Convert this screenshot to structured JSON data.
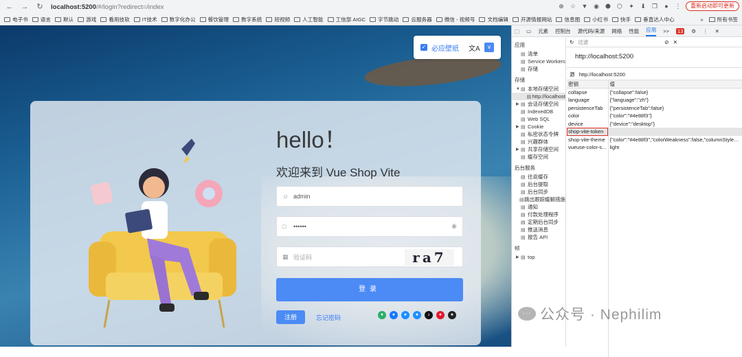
{
  "browser": {
    "url_host": "localhost:5200",
    "url_path": "/#/login?redirect=/index",
    "restart_label": "重新启动即可更新",
    "nav": {
      "back": "←",
      "forward": "→",
      "reload": "↻"
    },
    "toolbar_icons": [
      "⊕",
      "☆",
      "▼",
      "◉",
      "⬢",
      "⬡",
      "✦",
      "⬇",
      "❐",
      "●",
      "⋮"
    ]
  },
  "bookmarks": [
    "电子书",
    "语言",
    "默认",
    "游戏",
    "看用技软",
    "IT技术",
    "数字化办公",
    "餐饮管理",
    "数字系统",
    "短视频",
    "人工智能",
    "工信部 AIGC",
    "字节跳动",
    "云服务器",
    "微信 - 视频号",
    "文档编辑",
    "开源情报网站",
    "信息图",
    "小红书",
    "快手",
    "垂直达人中心"
  ],
  "bookmarks_more": "»",
  "bookmarks_all": "所有书签",
  "app": {
    "wallpaper_label": "必应壁纸",
    "wallpaper_check": "✓",
    "translate_icon": "文A",
    "dropdown_icon": "∨",
    "hello": "hello！",
    "welcome": "欢迎来到 Vue Shop Vite",
    "username": "admin",
    "password": "••••••",
    "captcha_placeholder": "验证码",
    "captcha_text": "ra7",
    "login": "登录",
    "register": "注册",
    "forgot": "忘记密码",
    "socials": [
      {
        "name": "wechat",
        "color": "#2aae67",
        "glyph": "●"
      },
      {
        "name": "alipay",
        "color": "#1677ff",
        "glyph": "●"
      },
      {
        "name": "dingtalk",
        "color": "#1890ff",
        "glyph": "●"
      },
      {
        "name": "qq",
        "color": "#1e90ff",
        "glyph": "●"
      },
      {
        "name": "tiktok",
        "color": "#111111",
        "glyph": "♪"
      },
      {
        "name": "weibo",
        "color": "#e6162d",
        "glyph": "●"
      },
      {
        "name": "github",
        "color": "#222222",
        "glyph": "●"
      }
    ]
  },
  "devtools": {
    "tabs": [
      "元素",
      "控制台",
      "源代码/来源",
      "网络",
      "性能",
      "应用",
      ">>"
    ],
    "error_count": "13",
    "settings": "⚙",
    "more": "⋮",
    "close": "✕",
    "filter_placeholder": "过滤",
    "sections": {
      "app": "应用",
      "storage": "存储",
      "background": "后台服务",
      "frames": "帧"
    },
    "app_items": [
      "清单",
      "Service Workers",
      "存储"
    ],
    "storage_items": [
      {
        "label": "本地存储空间",
        "tri": "▼"
      },
      {
        "label": "http://localhost",
        "tri": "",
        "sel": true
      },
      {
        "label": "会话存储空间",
        "tri": "▶"
      },
      {
        "label": "IndexedDB",
        "tri": ""
      },
      {
        "label": "Web SQL",
        "tri": ""
      },
      {
        "label": "Cookie",
        "tri": "▶"
      },
      {
        "label": "私密状态令牌",
        "tri": ""
      },
      {
        "label": "兴趣群体",
        "tri": ""
      },
      {
        "label": "共享存储空间",
        "tri": "▶"
      },
      {
        "label": "缓存空间",
        "tri": ""
      }
    ],
    "bg_items": [
      "往返缓存",
      "后台提取",
      "后台同步",
      "跳出跟踪缓解措施",
      "通知",
      "付款处理程序",
      "定期后台同步",
      "推送消息",
      "报告 API"
    ],
    "frames_items": [
      "top"
    ],
    "origin": "http://localhost:5200",
    "source_label": "源",
    "source_value": "http://localhost:5200",
    "key_header": "密钥",
    "value_header": "值",
    "rows": [
      {
        "k": "collapse",
        "v": "{\"collapse\":false}"
      },
      {
        "k": "language",
        "v": "{\"language\":\"zh\"}"
      },
      {
        "k": "persistenceTab",
        "v": "{\"persistenceTab\":false}"
      },
      {
        "k": "color",
        "v": "{\"color\":\"#4e88f3\"}"
      },
      {
        "k": "device",
        "v": "{\"device\":\"desktop\"}"
      },
      {
        "k": "shop-vite-token",
        "v": "",
        "hl": true
      },
      {
        "k": "shop-vite-theme",
        "v": "{\"color\":\"#4e88f3\",\"colorWeakness\":false,\"columnStyle\":\"..."
      },
      {
        "k": "vueuse-color-s...",
        "v": "light"
      }
    ]
  },
  "watermark": {
    "text": "公众号 · Nephilim",
    "icon": "···"
  }
}
